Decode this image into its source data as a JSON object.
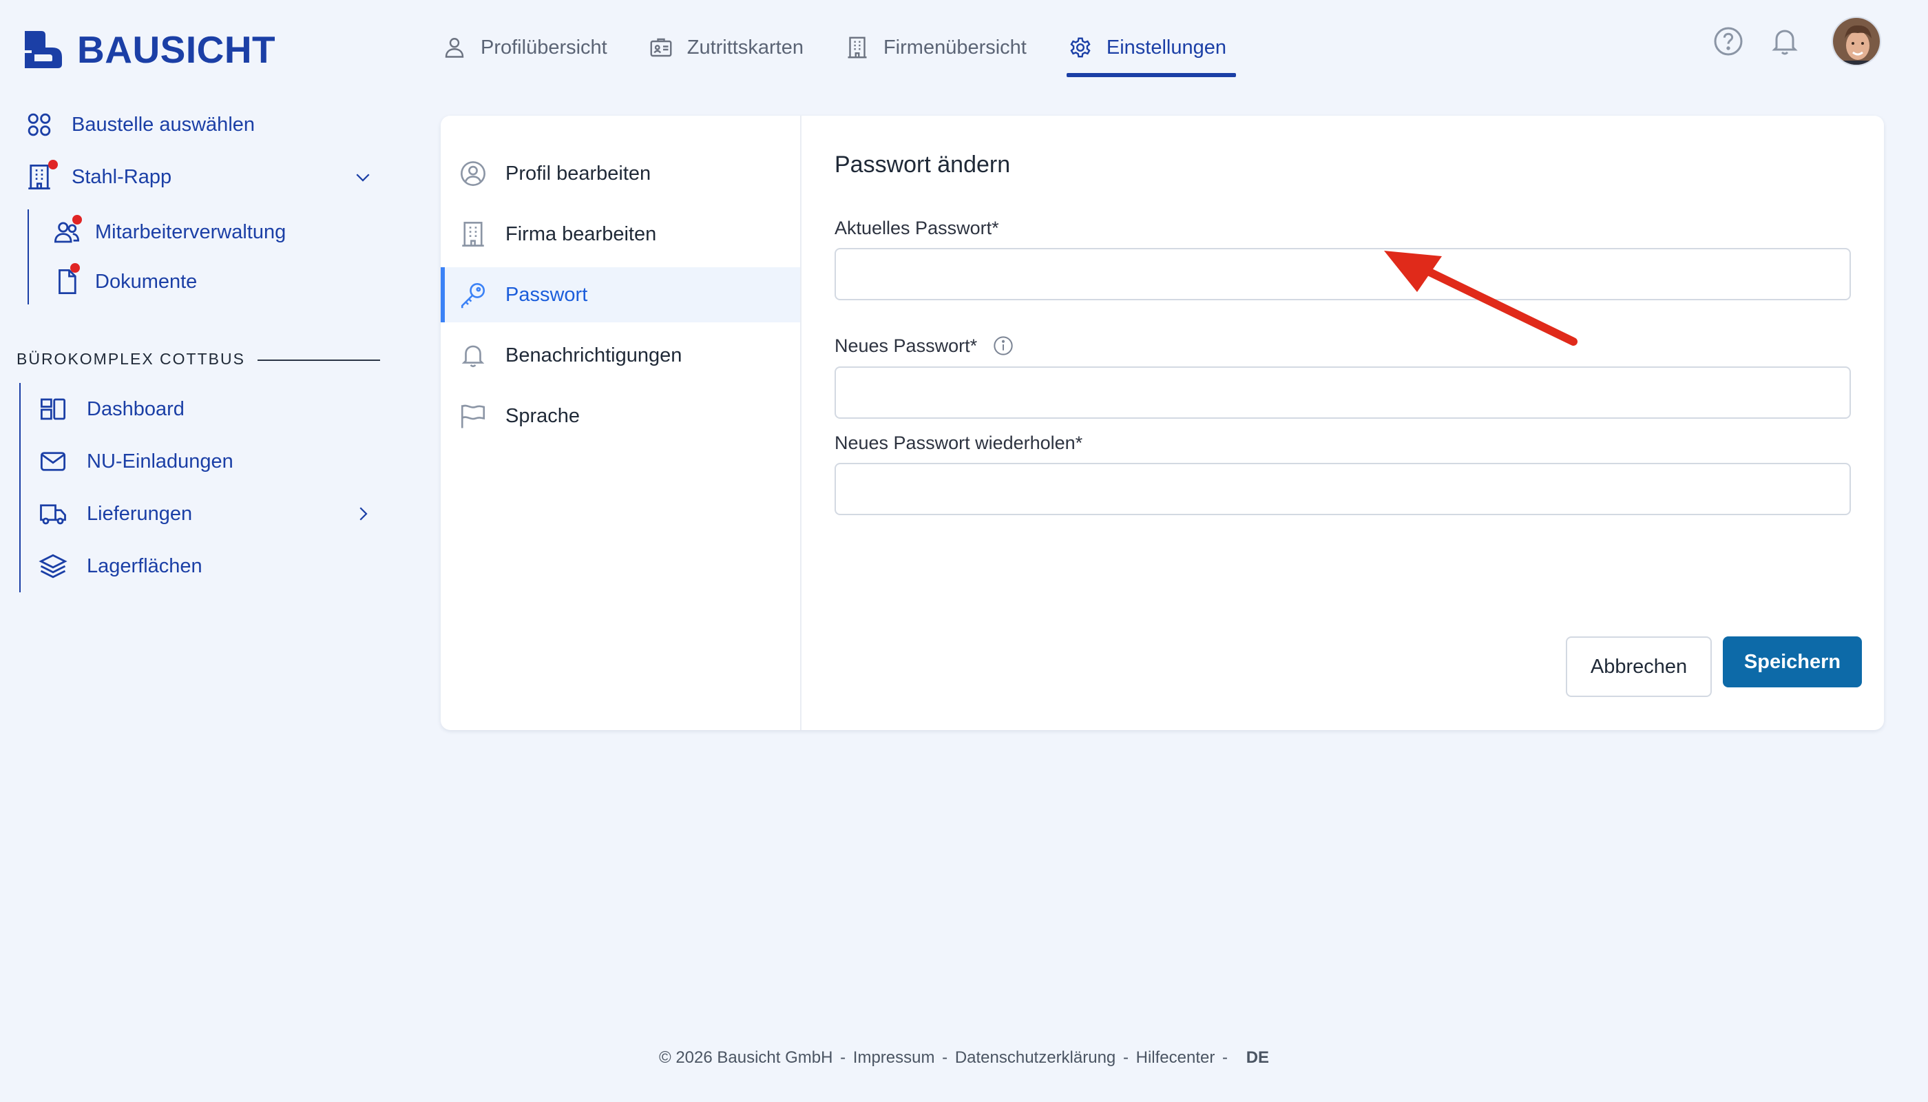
{
  "app": {
    "brand": "BAUSICHT",
    "colors": {
      "primary": "#1b3fa6",
      "accent": "#3b82f6",
      "save": "#0d6aa8",
      "notification": "#e02424",
      "annotation": "#e02a1a"
    }
  },
  "topnav": {
    "tabs": [
      {
        "label": "Profilübersicht",
        "icon": "user-icon",
        "active": false
      },
      {
        "label": "Zutrittskarten",
        "icon": "id-card-icon",
        "active": false
      },
      {
        "label": "Firmenübersicht",
        "icon": "building-icon",
        "active": false
      },
      {
        "label": "Einstellungen",
        "icon": "gear-icon",
        "active": true
      }
    ],
    "icons": [
      "help-icon",
      "bell-icon",
      "avatar"
    ]
  },
  "sidebar": {
    "select_site": "Baustelle auswählen",
    "company": "Stahl-Rapp",
    "company_children": [
      "Mitarbeiterverwaltung",
      "Dokumente"
    ],
    "section_title": "BÜROKOMPLEX COTTBUS",
    "section_items": [
      "Dashboard",
      "NU-Einladungen",
      "Lieferungen",
      "Lagerflächen"
    ]
  },
  "settings_menu": {
    "items": [
      {
        "label": "Profil bearbeiten",
        "icon": "user-circle-icon",
        "active": false
      },
      {
        "label": "Firma bearbeiten",
        "icon": "building-icon",
        "active": false
      },
      {
        "label": "Passwort",
        "icon": "key-icon",
        "active": true
      },
      {
        "label": "Benachrichtigungen",
        "icon": "bell-icon",
        "active": false
      },
      {
        "label": "Sprache",
        "icon": "flag-icon",
        "active": false
      }
    ]
  },
  "form": {
    "title": "Passwort ändern",
    "current_password": {
      "label": "Aktuelles Passwort*",
      "value": ""
    },
    "new_password": {
      "label": "Neues Passwort*",
      "value": ""
    },
    "repeat_password": {
      "label": "Neues Passwort wiederholen*",
      "value": ""
    },
    "cancel_label": "Abbrechen",
    "save_label": "Speichern"
  },
  "footer": {
    "copyright": "© 2026 Bausicht GmbH",
    "sep": "-",
    "links": [
      "Impressum",
      "Datenschutzerklärung",
      "Hilfecenter"
    ],
    "language": "DE"
  }
}
